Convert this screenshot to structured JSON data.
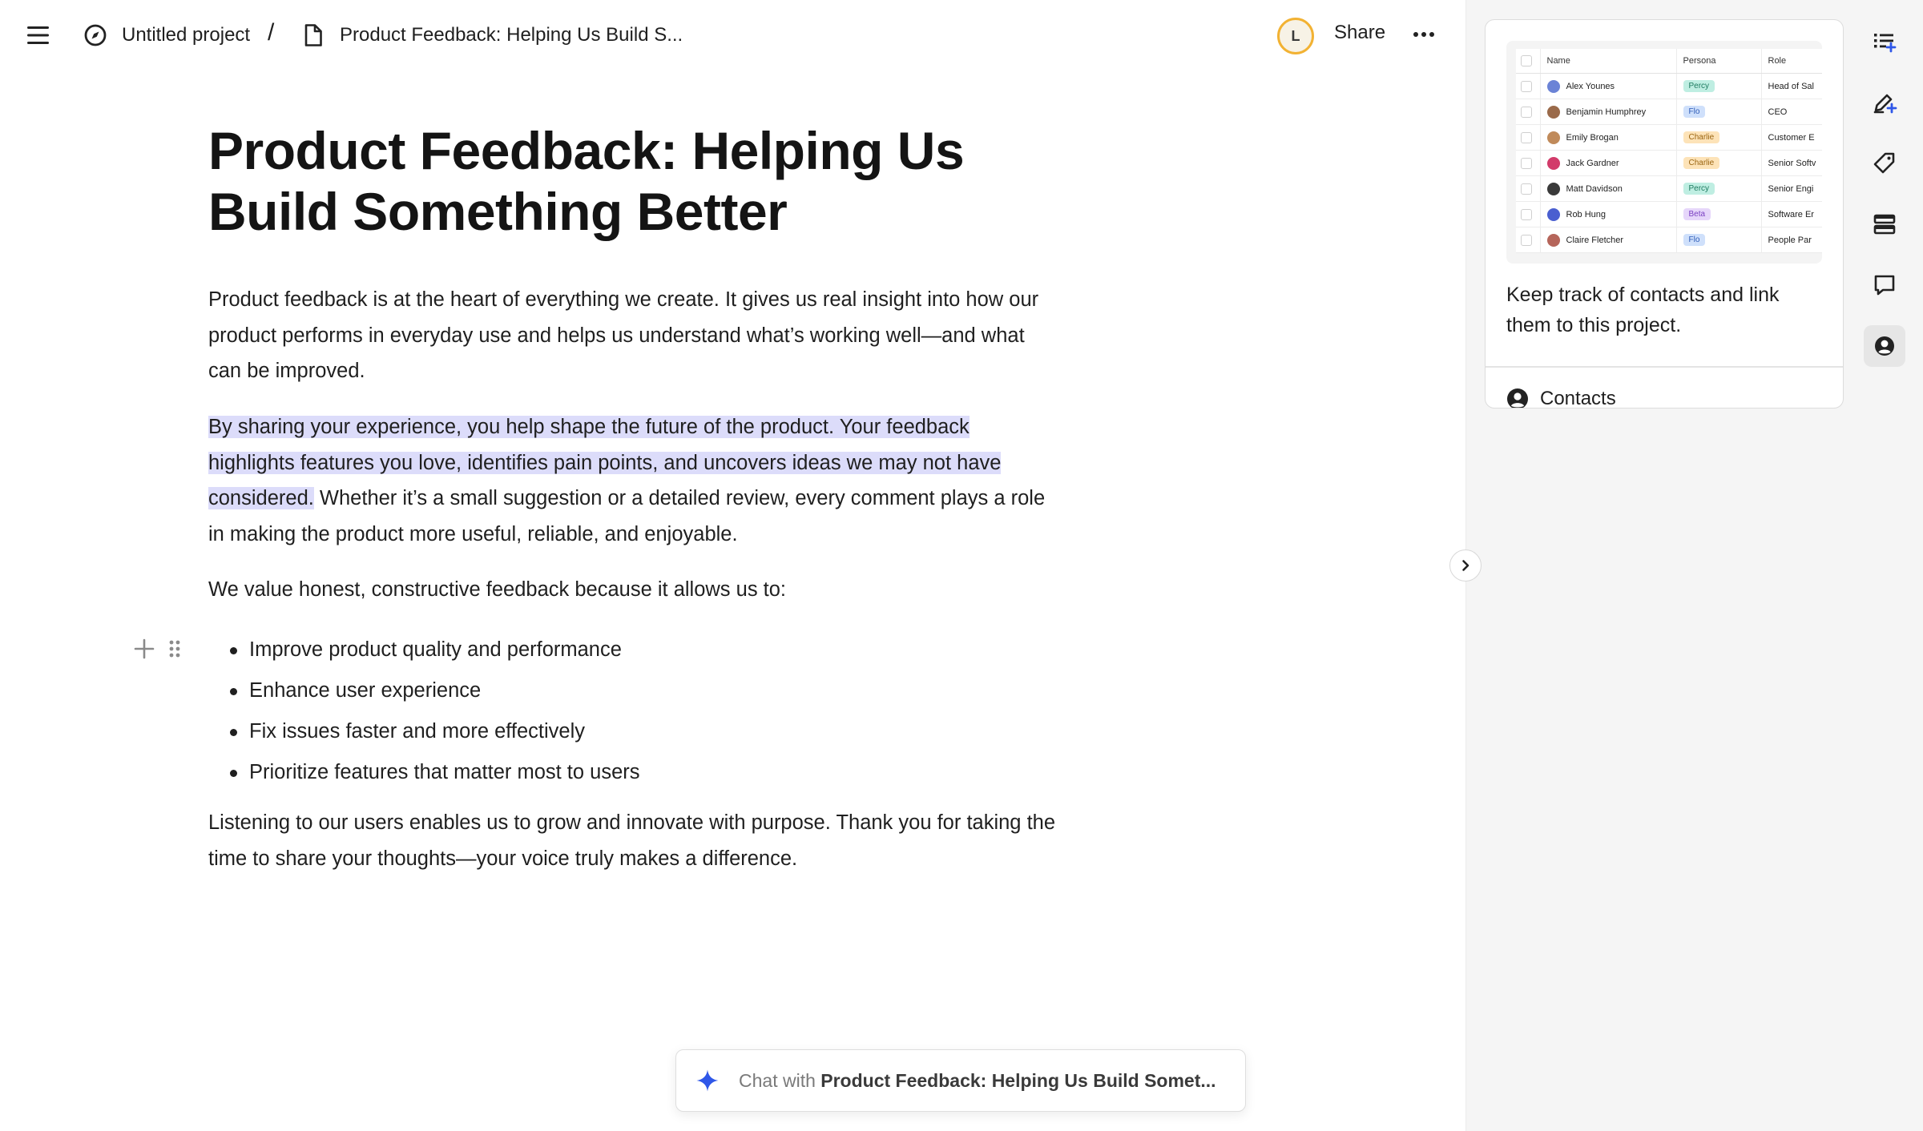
{
  "header": {
    "project_name": "Untitled project",
    "separator": "/",
    "doc_name": "Product Feedback: Helping Us Build S...",
    "avatar_initial": "L",
    "share_label": "Share"
  },
  "document": {
    "title": "Product Feedback: Helping Us Build Something Better",
    "p1": "Product feedback is at the heart of everything we create. It gives us real insight into how our product performs in everyday use and helps us understand what’s working well—and what can be improved.",
    "p2_highlighted": "By sharing your experience, you help shape the future of the product. Your feedback highlights features you love, identifies pain points, and uncovers ideas we may not have considered.",
    "p2_rest": " Whether it’s a small suggestion or a detailed review, every comment plays a role in making the product more useful, reliable, and enjoyable.",
    "p3": "We value honest, constructive feedback because it allows us to:",
    "bullets": [
      "Improve product quality and performance",
      "Enhance user experience",
      "Fix issues faster and more effectively",
      "Prioritize features that matter most to users"
    ],
    "p4": "Listening to our users enables us to grow and innovate with purpose. Thank you for taking the time to share your thoughts—your voice truly makes a difference."
  },
  "chat": {
    "prefix": "Chat with ",
    "doc_name": "Product Feedback: Helping Us Build Somet..."
  },
  "panel": {
    "preview_table": {
      "headers": [
        "Name",
        "Persona",
        "Role"
      ],
      "rows": [
        {
          "name": "Alex Younes",
          "persona": "Percy",
          "persona_color": "#bfeee2",
          "persona_text": "#1d7a5f",
          "role": "Head of Sal",
          "avatar_color": "#6b83d6"
        },
        {
          "name": "Benjamin Humphrey",
          "persona": "Flo",
          "persona_color": "#cfe0fb",
          "persona_text": "#2d5bb7",
          "role": "CEO",
          "avatar_color": "#9a6a4a"
        },
        {
          "name": "Emily Brogan",
          "persona": "Charlie",
          "persona_color": "#fde3b8",
          "persona_text": "#9a6410",
          "role": "Customer E",
          "avatar_color": "#c08a5a"
        },
        {
          "name": "Jack Gardner",
          "persona": "Charlie",
          "persona_color": "#fde3b8",
          "persona_text": "#9a6410",
          "role": "Senior Softv",
          "avatar_color": "#d23b6a"
        },
        {
          "name": "Matt Davidson",
          "persona": "Percy",
          "persona_color": "#bfeee2",
          "persona_text": "#1d7a5f",
          "role": "Senior Engi",
          "avatar_color": "#3a3a3a"
        },
        {
          "name": "Rob Hung",
          "persona": "Beta",
          "persona_color": "#e6d6fa",
          "persona_text": "#7a3fc2",
          "role": "Software Er",
          "avatar_color": "#4a5fd0"
        },
        {
          "name": "Claire Fletcher",
          "persona": "Flo",
          "persona_color": "#cfe0fb",
          "persona_text": "#2d5bb7",
          "role": "People Par",
          "avatar_color": "#b5655a"
        }
      ]
    },
    "card_description": "Keep track of contacts and link them to this project.",
    "card_footer_label": "Contacts"
  },
  "colors": {
    "highlight": "#dcdcfa",
    "avatar_ring": "#f2b233",
    "spark": "#2f57e8",
    "panel_bg": "#f5f5f5"
  },
  "icons": {
    "menu": "hamburger-icon",
    "project": "compass-icon",
    "doc": "document-icon",
    "more": "ellipsis-icon",
    "chat": "sparkle-icon",
    "rail": [
      "list-add-icon",
      "pen-plus-icon",
      "tag-icon",
      "layout-rows-icon",
      "comment-icon",
      "user-circle-icon"
    ]
  }
}
